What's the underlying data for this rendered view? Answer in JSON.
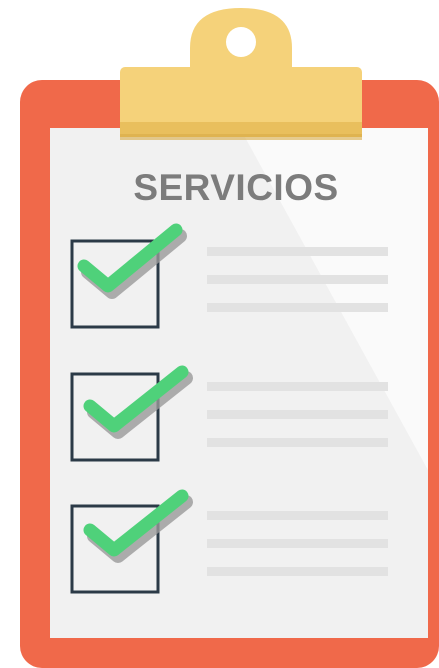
{
  "title": "SERVICIOS",
  "colors": {
    "board": "#f0694a",
    "paper": "#f5f5f5",
    "clip": "#f5d27a",
    "clip_shadow": "#e9bf5d",
    "title": "#7c7c7c",
    "check": "#4fd17a",
    "check_shadow": "#9a9a9a",
    "box_border": "#2b3a47",
    "line": "#e2e2e2"
  },
  "checklist": {
    "items": [
      {
        "checked": true
      },
      {
        "checked": true
      },
      {
        "checked": true
      }
    ]
  },
  "icons": [
    "clipboard-icon",
    "clip-icon",
    "check-icon"
  ]
}
